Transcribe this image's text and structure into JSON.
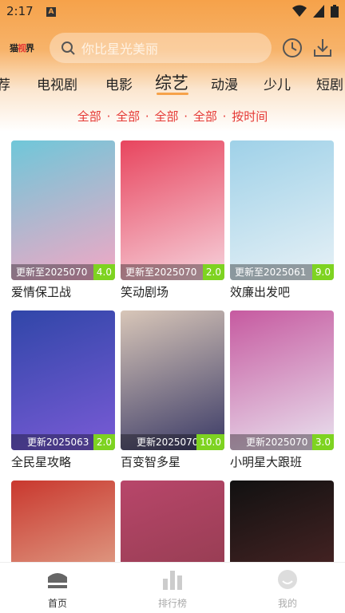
{
  "status": {
    "time": "2:17",
    "notification_icon": "a-icon"
  },
  "header": {
    "logo_text_1": "猫",
    "logo_text_2": "视",
    "logo_text_3": "界",
    "search_placeholder": "你比星光美丽",
    "icons": [
      "history-icon",
      "download-icon"
    ]
  },
  "tabs": [
    {
      "label": "荐"
    },
    {
      "label": "电视剧"
    },
    {
      "label": "电影"
    },
    {
      "label": "综艺",
      "active": true
    },
    {
      "label": "动漫"
    },
    {
      "label": "少儿"
    },
    {
      "label": "短剧"
    }
  ],
  "filters": [
    "全部",
    "全部",
    "全部",
    "全部",
    "按时间"
  ],
  "filter_sep": "·",
  "cards": [
    {
      "title": "爱情保卫战",
      "update": "更新至2025070",
      "score": "4.0",
      "colors": [
        "#6fc7d9",
        "#f3a7c4"
      ]
    },
    {
      "title": "笑动剧场",
      "update": "更新至2025070",
      "score": "2.0",
      "colors": [
        "#e8455e",
        "#f6d2dc"
      ]
    },
    {
      "title": "效廉出发吧",
      "update": "更新至2025061",
      "score": "9.0",
      "colors": [
        "#9fd1e8",
        "#e7f1f6"
      ]
    },
    {
      "title": "全民星攻略",
      "update": "更新2025063",
      "score": "2.0",
      "colors": [
        "#3046a8",
        "#7a5bd6"
      ]
    },
    {
      "title": "百变智多星",
      "update": "更新2025070",
      "score": "10.0",
      "colors": [
        "#d8c6b8",
        "#3a3a66"
      ]
    },
    {
      "title": "小明星大跟班",
      "update": "更新2025070",
      "score": "3.0",
      "colors": [
        "#c65aa0",
        "#e9e2ef"
      ]
    },
    {
      "title": "",
      "update": "",
      "score": "",
      "colors": [
        "#c9382e",
        "#e7c0a4"
      ]
    },
    {
      "title": "",
      "update": "",
      "score": "",
      "colors": [
        "#b8466a",
        "#8a3a4a"
      ]
    },
    {
      "title": "",
      "update": "",
      "score": "",
      "colors": [
        "#111111",
        "#5a2a2a"
      ]
    }
  ],
  "tabs_bar": [
    {
      "label": "首页",
      "icon": "home-icon",
      "active": true
    },
    {
      "label": "排行榜",
      "icon": "rank-bars-icon"
    },
    {
      "label": "我的",
      "icon": "profile-face-icon"
    }
  ]
}
